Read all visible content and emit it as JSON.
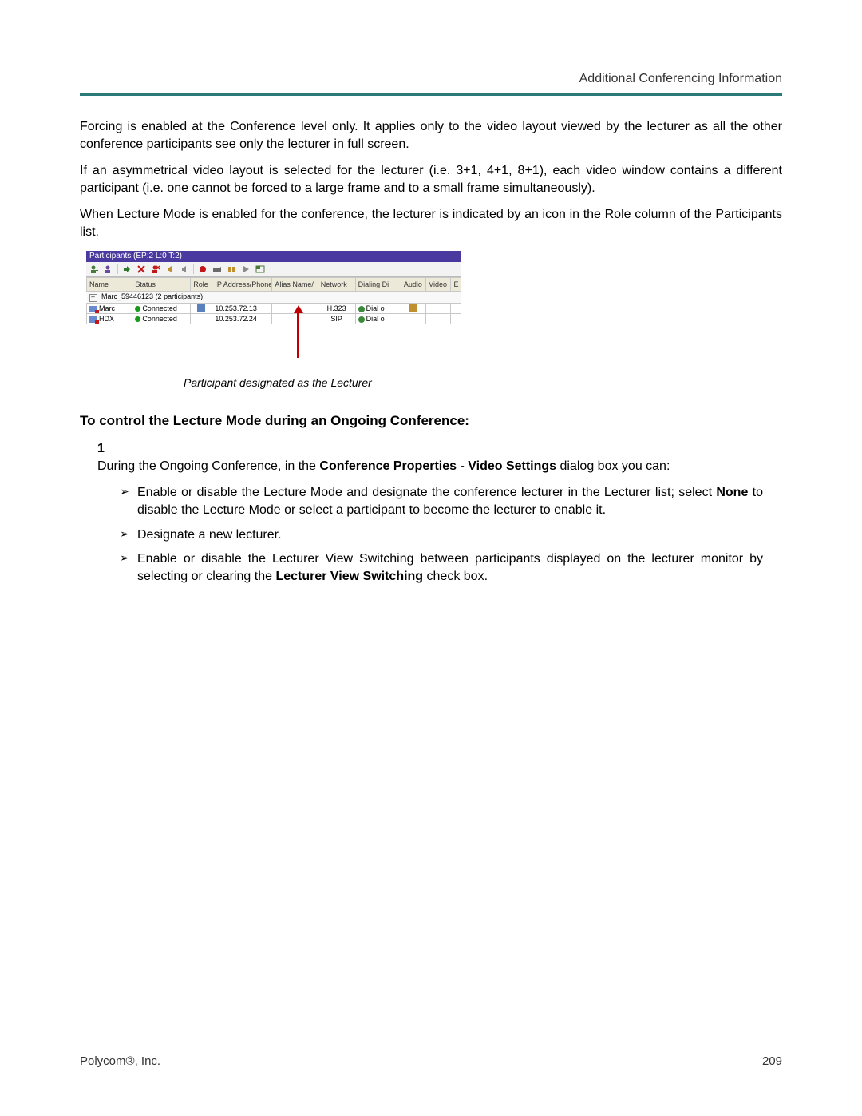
{
  "header": {
    "right": "Additional Conferencing Information"
  },
  "paragraphs": {
    "p1": "Forcing is enabled at the Conference level only. It applies only to the video layout viewed by the lecturer as all the other conference participants see only the lecturer in full screen.",
    "p2": "If an asymmetrical video layout is selected for the lecturer (i.e. 3+1, 4+1, 8+1), each video window contains a different participant (i.e. one cannot be forced to a large frame and to a small frame simultaneously).",
    "p3": "When Lecture Mode is enabled for the conference, the lecturer is indicated by an icon in the Role column of the Participants list."
  },
  "app": {
    "title": "Participants (EP:2 L:0 T:2)",
    "columns": [
      "Name",
      "Status",
      "Role",
      "IP Address/Phone",
      "Alias Name/",
      "Network",
      "Dialing Di",
      "Audio",
      "Video",
      "E"
    ],
    "group": "Marc_59446123 (2  participants)",
    "rows": [
      {
        "name": "Marc",
        "status": "Connected",
        "role_icon": true,
        "ip": "10.253.72.13",
        "alias": "",
        "network": "H.323",
        "dialing": "Dial o",
        "audio_icon": true
      },
      {
        "name": "HDX",
        "status": "Connected",
        "role_icon": false,
        "ip": "10.253.72.24",
        "alias": "",
        "network": "SIP",
        "dialing": "Dial o",
        "audio_icon": false
      }
    ]
  },
  "callout": "Participant designated as the Lecturer",
  "section": {
    "heading": "To control the Lecture Mode during an Ongoing Conference:",
    "step_num": "1",
    "step_text_pre": "During the Ongoing Conference, in the ",
    "step_text_bold": "Conference Properties - Video Settings",
    "step_text_post": " dialog box you can:",
    "bullets": {
      "b1_pre": "Enable or disable the Lecture Mode and designate the conference lecturer in the Lecturer list; select ",
      "b1_bold": "None",
      "b1_post": " to disable the Lecture Mode or select a participant to become the lecturer to enable it.",
      "b2": "Designate a new lecturer.",
      "b3_pre": "Enable or disable the Lecturer View Switching between participants displayed on the lecturer monitor by selecting or clearing the ",
      "b3_bold": "Lecturer View Switching",
      "b3_post": " check box."
    }
  },
  "footer": {
    "left": "Polycom®, Inc.",
    "right": "209"
  }
}
